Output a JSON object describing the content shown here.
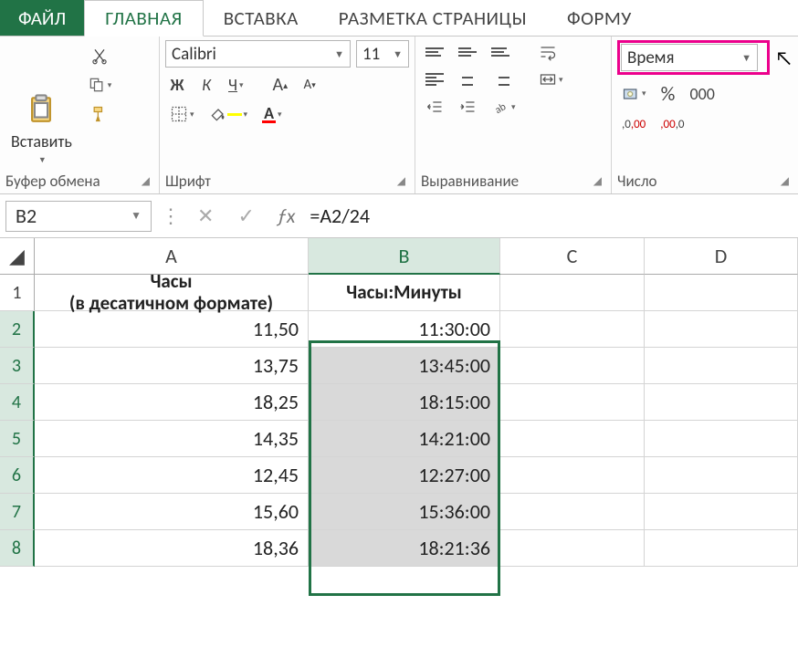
{
  "tabs": {
    "file": "ФАЙЛ",
    "home": "ГЛАВНАЯ",
    "insert": "ВСТАВКА",
    "pagelayout": "РАЗМЕТКА СТРАНИЦЫ",
    "formulas": "ФОРМУ"
  },
  "ribbon": {
    "clipboard": {
      "paste": "Вставить",
      "title": "Буфер обмена"
    },
    "font": {
      "name": "Calibri",
      "size": "11",
      "title": "Шрифт",
      "bold": "Ж",
      "italic": "К",
      "underline": "Ч"
    },
    "alignment": {
      "title": "Выравнивание"
    },
    "number": {
      "format": "Время",
      "title": "Число",
      "percent": "%"
    }
  },
  "formula_bar": {
    "cell_ref": "B2",
    "formula": "=A2/24"
  },
  "grid": {
    "columns": [
      "A",
      "B",
      "C",
      "D"
    ],
    "header_a": "Часы\n(в десатичном формате)",
    "header_b": "Часы:Минуты",
    "rows": [
      {
        "n": "2",
        "a": "11,50",
        "b": "11:30:00"
      },
      {
        "n": "3",
        "a": "13,75",
        "b": "13:45:00"
      },
      {
        "n": "4",
        "a": "18,25",
        "b": "18:15:00"
      },
      {
        "n": "5",
        "a": "14,35",
        "b": "14:21:00"
      },
      {
        "n": "6",
        "a": "12,45",
        "b": "12:27:00"
      },
      {
        "n": "7",
        "a": "15,60",
        "b": "15:36:00"
      },
      {
        "n": "8",
        "a": "18,36",
        "b": "18:21:36"
      }
    ]
  }
}
